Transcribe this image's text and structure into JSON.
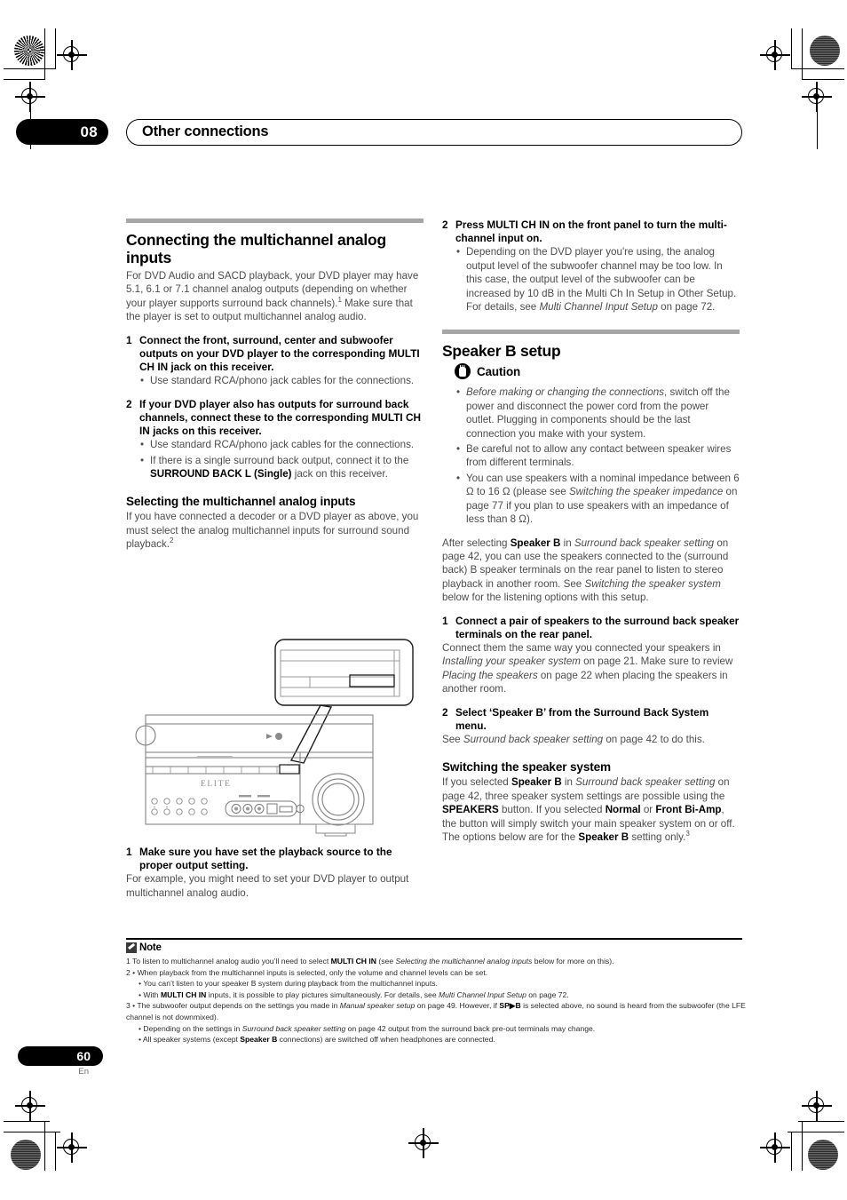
{
  "page": {
    "chapter_number": "08",
    "header_title": "Other connections",
    "page_number": "60",
    "language_code": "En"
  },
  "left_column": {
    "section_title": "Connecting the multichannel analog inputs",
    "intro_html": "For DVD Audio and SACD playback, your DVD player may have 5.1, 6.1 or 7.1 channel analog outputs (depending on whether your player supports surround back channels).<sup>1</sup> Make sure that the player is set to output multichannel analog audio.",
    "step1_num": "1",
    "step1_text": "Connect the front, surround, center and subwoofer outputs on your DVD player to the corresponding MULTI CH IN jack on this receiver.",
    "step1_bullets": [
      "Use standard RCA/phono jack cables for the connections."
    ],
    "step2_num": "2",
    "step2_text": "If your DVD player also has outputs for surround back channels, connect these to the corresponding MULTI CH IN jacks on this receiver.",
    "step2_bullets_html": [
      "Use standard RCA/phono jack cables for the connections.",
      "If there is a single surround back output, connect it to the <b>SURROUND BACK L (Single)</b> jack on this receiver."
    ],
    "subsection_title": "Selecting the multichannel analog inputs",
    "subsection_intro_html": "If you have connected a decoder or a DVD player as above, you must select the analog multichannel inputs for surround sound playback.<sup>2</sup>",
    "illustration_label": "ELITE",
    "step_a_num": "1",
    "step_a_text": "Make sure you have set the playback source to the proper output setting.",
    "step_a_body": "For example, you might need to set your DVD player to output multichannel analog audio."
  },
  "right_column": {
    "step_b_num": "2",
    "step_b_text": "Press MULTI CH IN on the front panel to turn the multi-channel input on.",
    "step_b_bullets_html": [
      "Depending on the DVD player you're using, the analog output level of the subwoofer channel may be too low. In this case, the output level of the subwoofer can be increased by 10 dB in the Multi Ch In Setup in Other Setup. For details, see <i>Multi Channel Input Setup</i> on page 72."
    ],
    "section_title": "Speaker B setup",
    "caution_label": "Caution",
    "caution_bullets_html": [
      "<i>Before making or changing the connections</i>, switch off the power and disconnect the power cord from the power outlet. Plugging in components should be the last connection you make with your system.",
      "Be careful not to allow any contact between speaker wires from different terminals.",
      "You can use speakers with a nominal impedance between 6 Ω to 16 Ω (please see <i>Switching the speaker impedance</i> on page 77 if you plan to use speakers with an impedance of less than 8 Ω)."
    ],
    "after_selecting_html": "After selecting <b>Speaker B</b> in <i>Surround back speaker setting</i> on page 42, you can use the speakers connected to the (surround back) B speaker terminals on the rear panel to listen to stereo playback in another room. See <i>Switching the speaker system</i> below for the listening options with this setup.",
    "step_c_num": "1",
    "step_c_text": "Connect a pair of speakers to the surround back speaker terminals on the rear panel.",
    "step_c_body_html": "Connect them the same way you connected your speakers in <i>Installing your speaker system</i> on page 21. Make sure to review <i>Placing the speakers</i> on page 22 when placing the speakers in another room.",
    "step_d_num": "2",
    "step_d_text": "Select ‘Speaker B’ from the Surround Back System menu.",
    "step_d_body_html": "See <i>Surround back speaker setting</i> on page 42 to do this.",
    "subsection_title": "Switching the speaker system",
    "subsection_body_html": "If you selected <b>Speaker B</b> in <i>Surround back speaker setting</i> on page 42, three speaker system settings are possible using the <b>SPEAKERS</b> button. If you selected <b>Normal</b> or <b>Front Bi-Amp</b>, the button will simply switch your main speaker system on or off. The options below are for the <b>Speaker B</b> setting only.<sup>3</sup>"
  },
  "footnotes": {
    "label": "Note",
    "items_html": [
      "1 To listen to multichannel analog audio you’ll need to select <b>MULTI CH IN</b> (see <i>Selecting the multichannel analog inputs</i> below for more on this).",
      "2 • When playback from the multichannel inputs is selected, only the volume and channel levels can be set."
    ],
    "items2_html": [
      "• You can’t listen to your speaker B system during playback from the multichannel inputs.",
      "• With <b>MULTI CH IN</b> inputs, it is possible to play pictures simultaneously. For details, see <i>Multi Channel Input Setup</i> on page 72."
    ],
    "item3_html": "3 • The subwoofer output depends on the settings you made in <i>Manual speaker setup</i> on page 49. However, if <b>SP▶B</b> is selected above, no sound is heard from the subwoofer (the LFE channel is not downmixed).",
    "items3_sub_html": [
      "• Depending on the settings in <i>Surround back speaker setting</i> on page 42 output from the surround back pre-out terminals may change.",
      "• All speaker systems (except <b>Speaker B</b> connections) are switched off when headphones are connected."
    ]
  }
}
